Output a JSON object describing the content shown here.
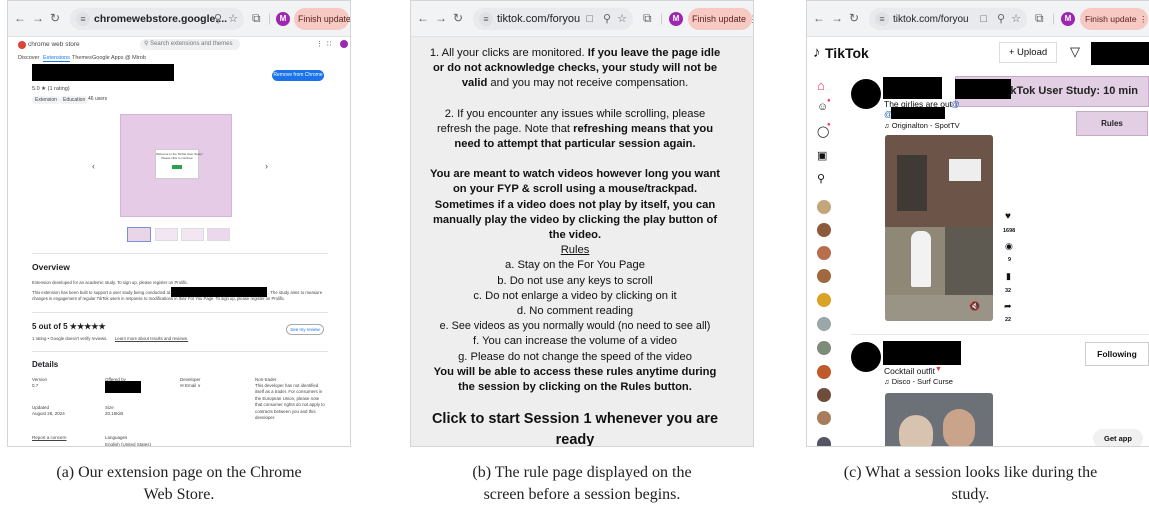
{
  "panel_a": {
    "browser": {
      "url": "chromewebstore.google....",
      "finish_update": "Finish update",
      "avatar": "M"
    },
    "store": {
      "logo_text": "chrome web store",
      "search_placeholder": "Search extensions and themes",
      "tabs": [
        "Discover",
        "Extensions",
        "Themes",
        "Google Apps @ Mirob"
      ],
      "rating": "5.0 ★ (1 rating)",
      "chips": [
        "Extension",
        "Education",
        "46 users"
      ],
      "remove_button": "Remove from Chrome",
      "slide_title": "Welcome to the TikTok User Study!",
      "slide_sub": "Please click to continue",
      "overview_heading": "Overview",
      "overview_line1": "Extension developed for an academic study. To sign up, please register on Prolific.",
      "overview_line2a": "This extension has been built to support a user study being conducted at the",
      "overview_line2b": ". The study aims to measure",
      "overview_line3": "changes in engagement of regular TikTok users in response to modifications in their For You Page. To sign up, please register on Prolific.",
      "score": "5 out of 5 ★★★★★",
      "score_note": "1 rating • Google doesn't verify reviews.",
      "score_link": "Learn more about results and reviews.",
      "see_review": "See my review",
      "details_heading": "Details",
      "version_label": "Version",
      "version_value": "0.7",
      "offered_label": "Offered by",
      "developer_label": "Developer",
      "developer_value": "✉ Email ∨",
      "trader_label": "Non-trader",
      "trader_text": "This developer has not identified itself as a trader. For consumers in the European Union, please note that consumer rights do not apply to contracts between you and this developer.",
      "updated_label": "Updated",
      "updated_value": "August 28, 2024",
      "size_label": "Size",
      "size_value": "20.16KiB",
      "report": "Report a concern",
      "languages_label": "Languages",
      "languages_value": "English (United States)"
    },
    "caption": [
      "(a) Our extension page on the Chrome",
      "Web Store."
    ]
  },
  "panel_b": {
    "browser": {
      "url": "tiktok.com/foryou",
      "finish_update": "Finish update",
      "avatar": "M"
    },
    "rules": {
      "p1_a": "1. All your clicks are monitored.",
      "p1_b": "If you leave the page idle or do not acknowledge checks, your study will not be valid",
      "p1_c": "and you may not receive compensation.",
      "p2_a": "2. If you encounter any issues while scrolling, please refresh the page. Note that",
      "p2_b": "refreshing means that you need to attempt that particular session again.",
      "p3": "You are meant to watch videos however long you want on your FYP & scroll using a mouse/trackpad. Sometimes if a video does not play by itself, you can manually play the video by clicking the play button of the video.",
      "rules_title": "Rules",
      "items": [
        "a. Stay on the For You Page",
        "b. Do not use any keys to scroll",
        "c. Do not enlarge a video by clicking on it",
        "d. No comment reading",
        "e. See videos as you normally would (no need to see all)",
        "f. You can increase the volume of a video",
        "g. Please do not change the speed of the video"
      ],
      "p4": "You will be able to access these rules anytime during the session by clicking on the Rules button.",
      "start": "Click to start Session 1 whenever you are ready"
    },
    "caption": [
      "(b) The rule page displayed on the",
      "screen before a session begins."
    ]
  },
  "panel_c": {
    "browser": {
      "url": "tiktok.com/foryou",
      "finish_update": "Finish update",
      "avatar": "M"
    },
    "tiktok": {
      "logo": "TikTok",
      "upload": "+ Upload",
      "study_banner": "TikTok User Study: 10 min",
      "rules_button": "Rules",
      "caption1": "The girlies are out",
      "caption1_at": "@",
      "caption1_at2": "@",
      "sound1": "♫ Originalton - SpotTV",
      "likes": "1698",
      "comments": "9",
      "saves": "32",
      "shares": "22",
      "caption2": "Cocktail outfit",
      "sound2": "♫ Disco - Surf Curse",
      "following": "Following",
      "get_app": "Get app"
    },
    "caption": [
      "(c) What a session looks like during the",
      "study."
    ]
  }
}
